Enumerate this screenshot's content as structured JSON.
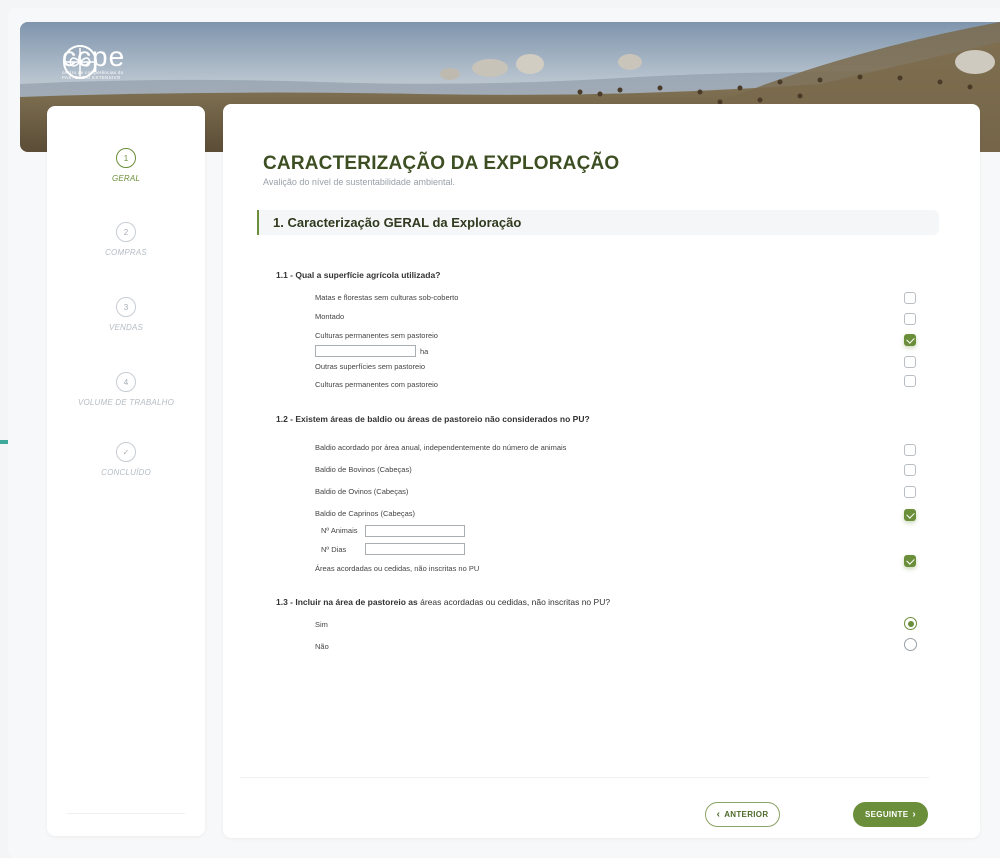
{
  "brand": {
    "name": "ccpe",
    "subtitle_line1": "centro de competências do",
    "subtitle_line2": "PASTOREIO EXTENSIVO"
  },
  "steps": [
    {
      "number": "1",
      "label": "GERAL",
      "active": true
    },
    {
      "number": "2",
      "label": "COMPRAS",
      "active": false
    },
    {
      "number": "3",
      "label": "VENDAS",
      "active": false
    },
    {
      "number": "4",
      "label": "VOLUME DE TRABALHO",
      "active": false
    },
    {
      "number": "✓",
      "label": "CONCLUÍDO",
      "active": false
    }
  ],
  "page": {
    "title": "CARACTERIZAÇÃO DA EXPLORAÇÃO",
    "subtitle": "Avalição do nível de sustentabilidade ambiental."
  },
  "section": {
    "title": "1. Caracterização GERAL da Exploração"
  },
  "q1": {
    "title": "1.1 -  Qual a superfície agrícola utilizada?",
    "options": [
      {
        "label": "Matas e florestas sem culturas sob-coberto",
        "checked": false
      },
      {
        "label": "Montado",
        "checked": false
      },
      {
        "label": "Culturas permanentes sem pastoreio",
        "checked": true
      },
      {
        "label": "Outras superfícies sem pastoreio",
        "checked": false
      },
      {
        "label": "Culturas permanentes com pastoreio",
        "checked": false
      }
    ],
    "area_input_value": "",
    "area_unit": "ha"
  },
  "q2": {
    "title": "1.2 -  Existem áreas de baldio ou áreas de pastoreio não considerados no PU?",
    "options": [
      {
        "label": "Baldio acordado por área anual, independentemente do número de animais",
        "checked": false
      },
      {
        "label": "Baldio de Bovinos (Cabeças)",
        "checked": false
      },
      {
        "label": "Baldio de Ovinos (Cabeças)",
        "checked": false
      },
      {
        "label": "Baldio de Caprinos (Cabeças)",
        "checked": true
      },
      {
        "label": "Áreas acordadas ou cedidas, não inscritas no PU",
        "checked": true
      }
    ],
    "animals_label": "Nº Animais",
    "animals_value": "",
    "days_label": "Nº Dias",
    "days_value": ""
  },
  "q3": {
    "title_prefix": "1.3 -  Incluir na área de pastoreio as",
    "title_suffix": "áreas acordadas ou cedidas, não inscritas no PU?",
    "options": [
      {
        "label": "Sim",
        "selected": true
      },
      {
        "label": "Não",
        "selected": false
      }
    ]
  },
  "buttons": {
    "prev": "ANTERIOR",
    "next": "SEGUINTE"
  },
  "colors": {
    "accent": "#6b8e3a",
    "title": "#3d4f22"
  }
}
